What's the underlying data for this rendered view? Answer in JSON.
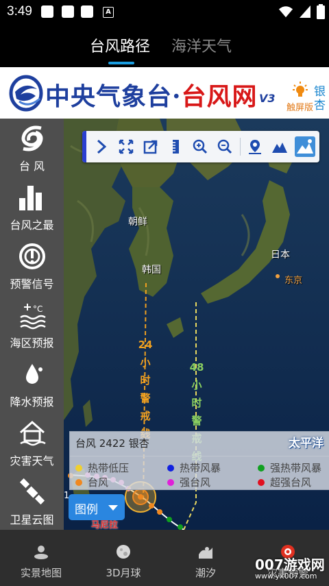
{
  "status": {
    "time": "3:49"
  },
  "tabs": [
    {
      "label": "台风路径",
      "active": true
    },
    {
      "label": "海洋天气",
      "active": false
    }
  ],
  "banner": {
    "title_main": "中央气象台·",
    "title_red": "台风网",
    "version": "V3",
    "touch_label": "触屏版",
    "typhoon_name_vertical": "银杏"
  },
  "sidebar": {
    "items": [
      {
        "label": "台 风",
        "icon": "typhoon-icon"
      },
      {
        "label": "台风之最",
        "icon": "bar-chart-icon"
      },
      {
        "label": "预警信号",
        "icon": "warning-signal-icon"
      },
      {
        "label": "海区预报",
        "icon": "sea-forecast-icon"
      },
      {
        "label": "降水预报",
        "icon": "rain-drop-icon"
      },
      {
        "label": "灾害天气",
        "icon": "disaster-weather-icon"
      },
      {
        "label": "卫星云图",
        "icon": "satellite-icon"
      }
    ]
  },
  "toolbar": {
    "buttons": [
      "expand-arrow-icon",
      "fullscreen-icon",
      "export-icon",
      "ruler-icon",
      "zoom-in-icon",
      "zoom-out-icon",
      "location-pin-icon",
      "terrain-icon",
      "satellite-map-icon"
    ]
  },
  "map": {
    "labels": {
      "chaoxian": "朝鲜",
      "hanguo": "韩国",
      "riben": "日本",
      "dongjing": "东京",
      "warn24": [
        "24",
        "小",
        "时",
        "警",
        "戒",
        "线"
      ],
      "warn48": [
        "48",
        "小",
        "时",
        "警",
        "戒",
        "线"
      ],
      "fragment_left": "1",
      "fragment_bottom": "马尼拉"
    }
  },
  "legend": {
    "header": "台风    2422 银杏",
    "ocean": "太平洋",
    "items": [
      {
        "label": "热带低压",
        "color": "#f0d030"
      },
      {
        "label": "热带风暴",
        "color": "#1020e0"
      },
      {
        "label": "强热带风暴",
        "color": "#10a020"
      },
      {
        "label": "台风",
        "color": "#f08820"
      },
      {
        "label": "强台风",
        "color": "#e020d8"
      },
      {
        "label": "超强台风",
        "color": "#e01020"
      }
    ],
    "button_label": "图例"
  },
  "bottomnav": {
    "items": [
      {
        "label": "实景地图",
        "icon": "map-person-icon"
      },
      {
        "label": "3D月球",
        "icon": "moon-icon"
      },
      {
        "label": "潮汐",
        "icon": "tide-icon"
      },
      {
        "label": "灾害预警",
        "icon": "alert-icon"
      }
    ]
  },
  "watermark": {
    "line1": "007游戏网",
    "line2": "www.yx007.com"
  }
}
